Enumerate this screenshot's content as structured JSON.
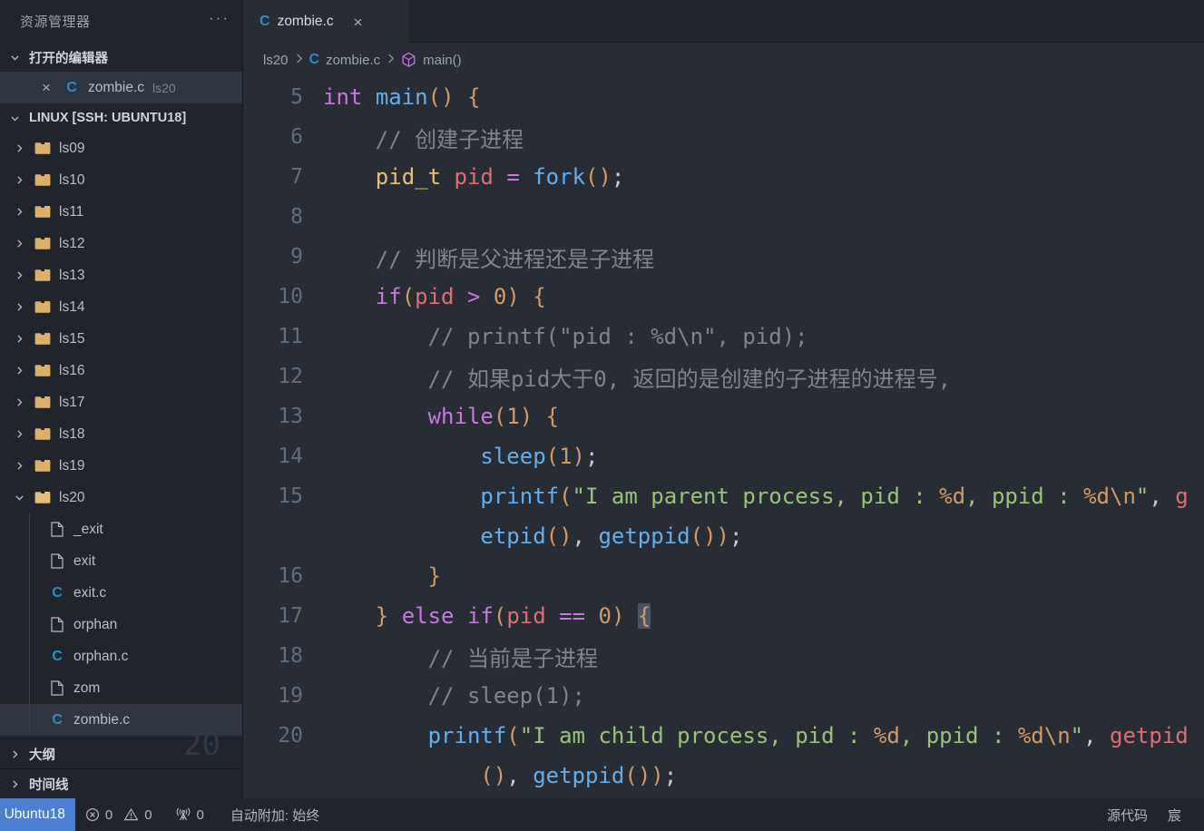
{
  "sidebar": {
    "title": "资源管理器",
    "more_actions": "···",
    "open_editors": {
      "label": "打开的编辑器",
      "items": [
        {
          "name": "zombie.c",
          "folder": "ls20",
          "icon": "c-file-icon",
          "close": "×"
        }
      ]
    },
    "workspace": {
      "label": "LINUX [SSH: UBUNTU18]",
      "folders": [
        "ls09",
        "ls10",
        "ls11",
        "ls12",
        "ls13",
        "ls14",
        "ls15",
        "ls16",
        "ls17",
        "ls18",
        "ls19"
      ],
      "expanded_folder": "ls20",
      "files": [
        {
          "name": "_exit",
          "icon": "plain-file-icon"
        },
        {
          "name": "exit",
          "icon": "plain-file-icon"
        },
        {
          "name": "exit.c",
          "icon": "c-file-icon"
        },
        {
          "name": "orphan",
          "icon": "plain-file-icon"
        },
        {
          "name": "orphan.c",
          "icon": "c-file-icon"
        },
        {
          "name": "zom",
          "icon": "plain-file-icon"
        },
        {
          "name": "zombie.c",
          "icon": "c-file-icon",
          "selected": true
        }
      ],
      "watermark": "20"
    },
    "outline": "大纲",
    "timeline": "时间线"
  },
  "tabs": [
    {
      "label": "zombie.c",
      "icon": "c-file-icon",
      "close": "×",
      "active": true
    }
  ],
  "breadcrumb": {
    "folder": "ls20",
    "file": "zombie.c",
    "symbol": "main()",
    "separator": ">"
  },
  "code": {
    "language": "c",
    "lines": [
      {
        "n": "5",
        "text": "int main() {"
      },
      {
        "n": "6",
        "text": "    // 创建子进程"
      },
      {
        "n": "7",
        "text": "    pid_t pid = fork();"
      },
      {
        "n": "8",
        "text": ""
      },
      {
        "n": "9",
        "text": "    // 判断是父进程还是子进程"
      },
      {
        "n": "10",
        "text": "    if(pid > 0) {"
      },
      {
        "n": "11",
        "text": "        // printf(\"pid : %d\\n\", pid);"
      },
      {
        "n": "12",
        "text": "        // 如果pid大于0, 返回的是创建的子进程的进程号,"
      },
      {
        "n": "13",
        "text": "        while(1) {"
      },
      {
        "n": "14",
        "text": "            sleep(1);"
      },
      {
        "n": "15",
        "text": "            printf(\"I am parent process, pid : %d, ppid : %d\\n\", getpid(), getppid());"
      },
      {
        "n": "16",
        "text": "        }"
      },
      {
        "n": "17",
        "text": "    } else if(pid == 0) {"
      },
      {
        "n": "18",
        "text": "        // 当前是子进程"
      },
      {
        "n": "19",
        "text": "        // sleep(1);"
      },
      {
        "n": "20",
        "text": "        printf(\"I am child process, pid : %d, ppid : %d\\n\", getpid(), getppid());"
      }
    ],
    "cursor_line": "17"
  },
  "status": {
    "remote": ": Ubuntu18",
    "errors": "0",
    "warnings": "0",
    "ports": "0",
    "auto_attach": "自动附加: 始终",
    "source_control": "源代码",
    "ime": "宸"
  }
}
